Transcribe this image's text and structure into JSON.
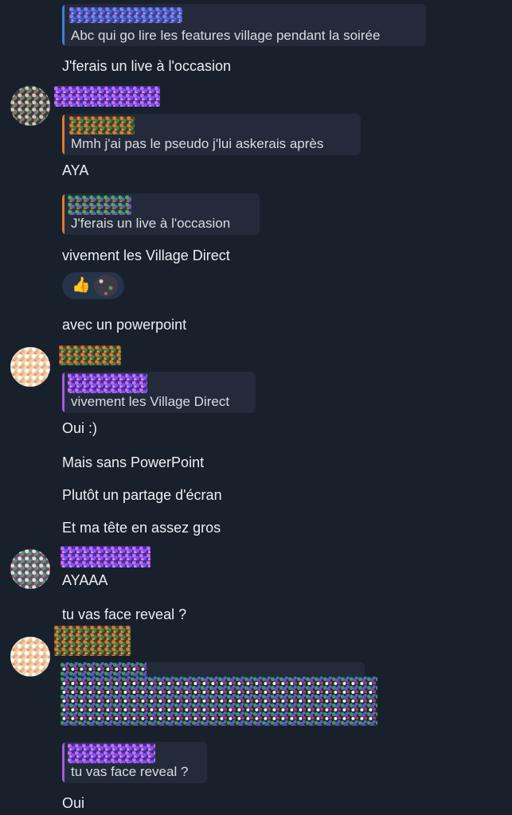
{
  "colors": {
    "background": "#18202c",
    "reply_bubble": "#232b3a",
    "accent_blue": "#3f7fd3",
    "accent_orange": "#e27a2e",
    "accent_purple": "#a35be0"
  },
  "messages": [
    {
      "quote": "Abc qui go lire les features village pendant la soirée"
    },
    {
      "text": "J'ferais un live à l'occasion"
    },
    {
      "quote": "Mmh j'ai pas le pseudo j'lui askerais après"
    },
    {
      "text": "AYA"
    },
    {
      "quote": "J'ferais un live à l'occasion"
    },
    {
      "text": "vivement les Village Direct"
    },
    {
      "reaction_emoji": "👍"
    },
    {
      "text": "avec un powerpoint"
    },
    {
      "quote": "vivement les Village Direct"
    },
    {
      "text": "Oui :)"
    },
    {
      "text": "Mais sans PowerPoint"
    },
    {
      "text": "Plutôt un partage d'écran"
    },
    {
      "text": "Et ma tête en assez gros"
    },
    {
      "text": "AYAAA"
    },
    {
      "text": "tu vas face reveal ?"
    },
    {
      "quote": "tu vas face reveal ?"
    },
    {
      "text": "Oui"
    }
  ]
}
